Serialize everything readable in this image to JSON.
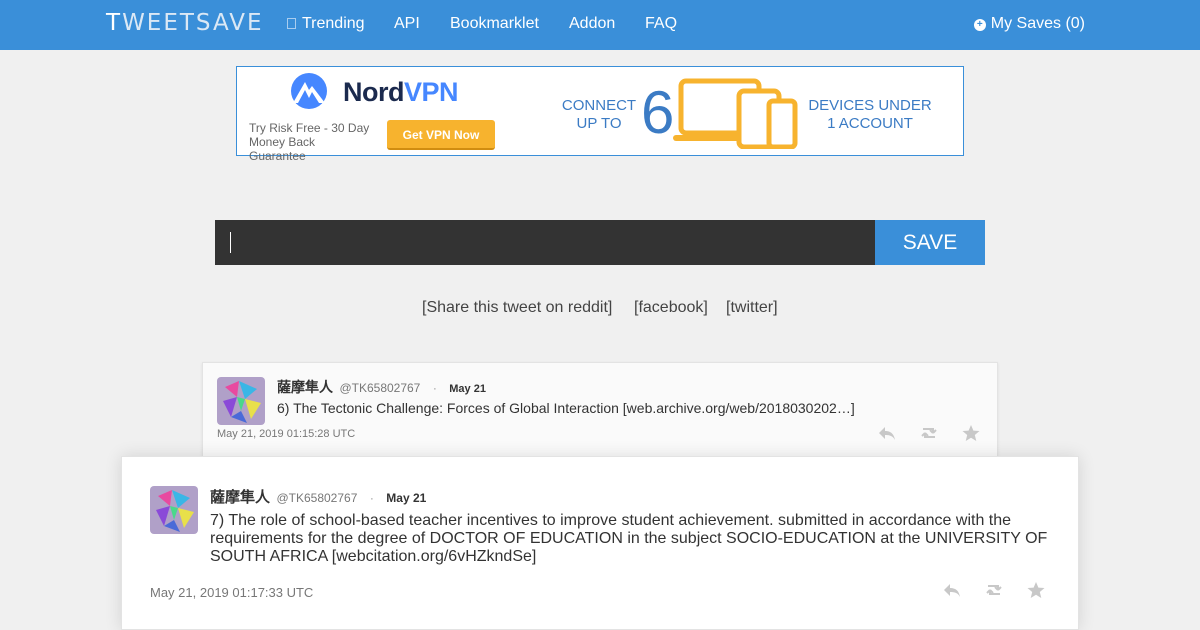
{
  "navbar": {
    "brand_first": "T",
    "brand_rest": "WEETSAVE",
    "links": [
      "Trending",
      "API",
      "Bookmarklet",
      "Addon",
      "FAQ"
    ],
    "my_saves": "My Saves (0)",
    "color": "#3a8fd9"
  },
  "ad": {
    "brand_nord": "Nord",
    "brand_vpn": "VPN",
    "guarantee": "Try Risk Free - 30 Day Money Back Guarantee",
    "cta": "Get VPN Now",
    "connect": "CONNECT UP TO",
    "six": "6",
    "devices": "DEVICES UNDER 1 ACCOUNT"
  },
  "form": {
    "input_value": "",
    "save_label": "SAVE"
  },
  "share": {
    "reddit": "[Share this tweet on reddit]",
    "facebook": "[facebook]",
    "twitter": "[twitter]"
  },
  "tweets": [
    {
      "author": "薩摩隼人",
      "handle": "@TK65802767",
      "sep": "·",
      "date": "May 21",
      "text": "6) The Tectonic Challenge: Forces of Global Interaction [web.archive.org/web/2018030202…]",
      "timestamp": "May 21, 2019 01:15:28 UTC"
    },
    {
      "author": "薩摩隼人",
      "handle": "@TK65802767",
      "sep": "·",
      "date": "May 21",
      "text": "7) The role of school-based teacher incentives to improve student achievement. submitted in accordance with the requirements for the degree of DOCTOR OF EDUCATION in the subject SOCIO-EDUCATION at the UNIVERSITY OF SOUTH AFRICA [webcitation.org/6vHZkndSe]",
      "timestamp": "May 21, 2019 01:17:33 UTC"
    }
  ]
}
